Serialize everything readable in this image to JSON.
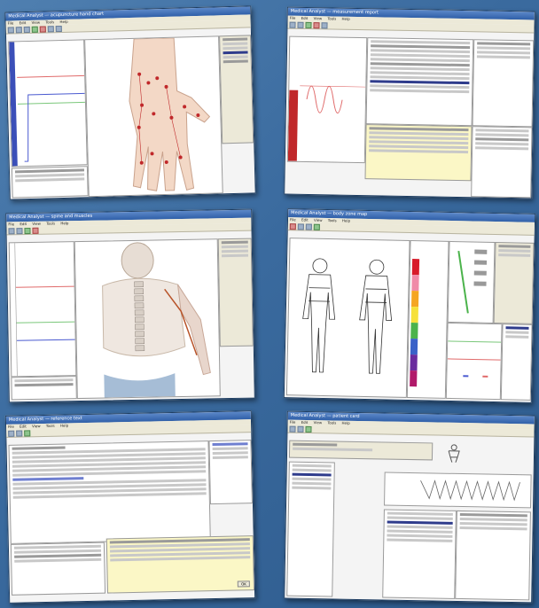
{
  "screenshots": [
    {
      "title": "Medical Analyst — acupuncture hand chart"
    },
    {
      "title": "Medical Analyst — measurement report"
    },
    {
      "title": "Medical Analyst — spine and muscles"
    },
    {
      "title": "Medical Analyst — body zone map"
    },
    {
      "title": "Medical Analyst — reference text"
    },
    {
      "title": "Medical Analyst — patient card"
    }
  ],
  "menu_items": [
    "File",
    "Edit",
    "View",
    "Tools",
    "Help"
  ],
  "popup_button": "OK",
  "colors": {
    "background": "#3a6a9e",
    "window_border": "#1d3d62",
    "chart_red": "#e06a6a",
    "chart_green": "#7ac77a",
    "chart_blue": "#4a5ad0",
    "selection": "#2f3c8c",
    "note_yellow": "#fbf7c6"
  }
}
